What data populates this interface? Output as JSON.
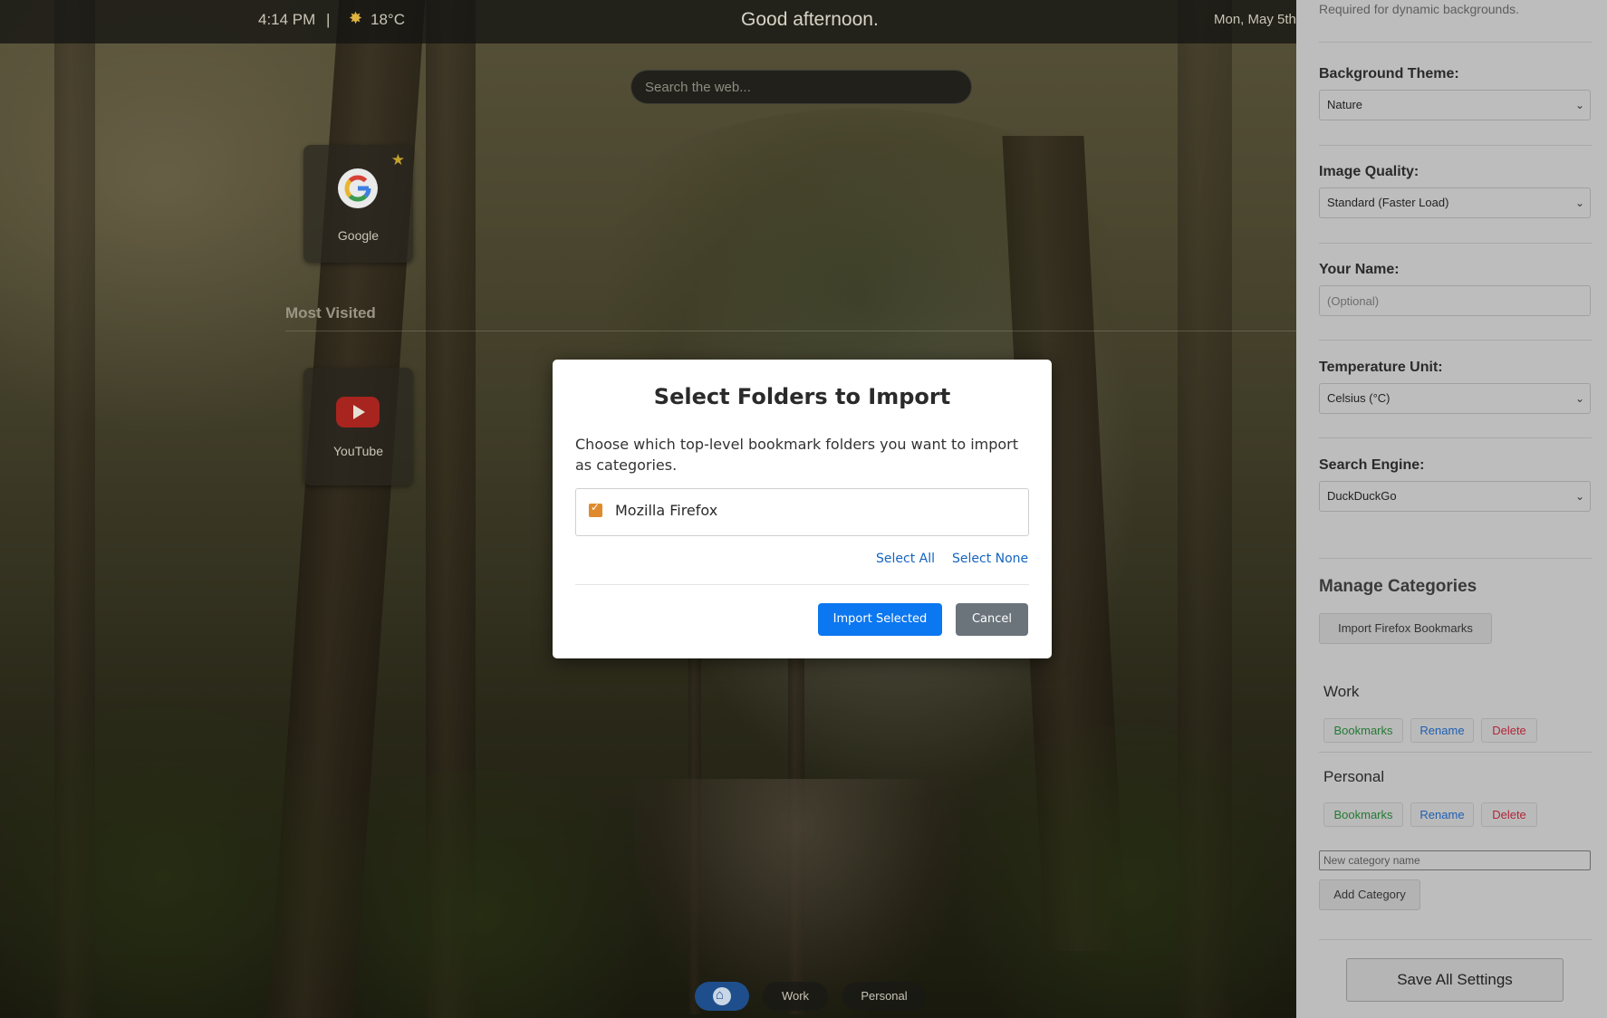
{
  "topbar": {
    "time": "4:14 PM",
    "separator": "|",
    "weather_icon": "sun-icon",
    "temperature": "18°C",
    "greeting": "Good afternoon.",
    "date": "Mon, May 5th"
  },
  "search": {
    "placeholder": "Search the web..."
  },
  "favorites": [
    {
      "label": "Google",
      "icon": "google-icon",
      "starred": true
    }
  ],
  "most_visited": {
    "title": "Most Visited",
    "items": [
      {
        "label": "YouTube",
        "icon": "youtube-icon"
      }
    ]
  },
  "bottom_nav": {
    "home_icon": "home-icon",
    "tabs": [
      "Work",
      "Personal"
    ]
  },
  "settings": {
    "note": "Required for dynamic backgrounds.",
    "background_theme": {
      "label": "Background Theme:",
      "value": "Nature"
    },
    "image_quality": {
      "label": "Image Quality:",
      "value": "Standard (Faster Load)"
    },
    "your_name": {
      "label": "Your Name:",
      "placeholder": "(Optional)"
    },
    "temperature_unit": {
      "label": "Temperature Unit:",
      "value": "Celsius (°C)"
    },
    "search_engine": {
      "label": "Search Engine:",
      "value": "DuckDuckGo"
    },
    "manage_categories": {
      "title": "Manage Categories",
      "import_button": "Import Firefox Bookmarks",
      "categories": [
        {
          "name": "Work",
          "bookmarks": "Bookmarks",
          "rename": "Rename",
          "delete": "Delete"
        },
        {
          "name": "Personal",
          "bookmarks": "Bookmarks",
          "rename": "Rename",
          "delete": "Delete"
        }
      ],
      "new_category_placeholder": "New category name",
      "add_button": "Add Category"
    },
    "save_all": "Save All Settings"
  },
  "modal": {
    "title": "Select Folders to Import",
    "description": "Choose which top-level bookmark folders you want to import as categories.",
    "folders": [
      {
        "name": "Mozilla Firefox",
        "checked": true
      }
    ],
    "select_all": "Select All",
    "select_none": "Select None",
    "import_button": "Import Selected",
    "cancel_button": "Cancel"
  },
  "colors": {
    "primary": "#0b77f0",
    "cancel": "#6b737b",
    "checkbox": "#e08a2e",
    "link": "#1565c0",
    "home_nav": "#1e4f8c"
  }
}
